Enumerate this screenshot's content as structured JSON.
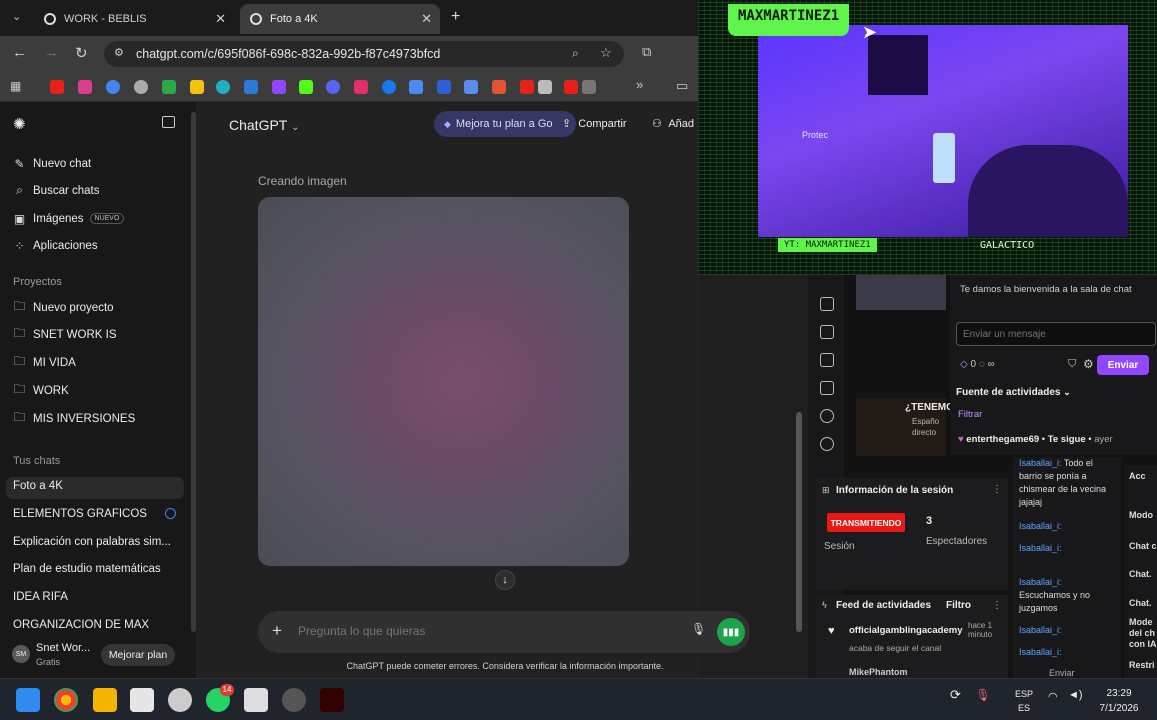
{
  "browser": {
    "tabs": [
      {
        "label": "WORK - BEBLIS"
      },
      {
        "label": "Foto a 4K"
      }
    ],
    "url": "chatgpt.com/c/695f086f-698c-832a-992b-f87c4973bfcd"
  },
  "sidebar": {
    "top_items": [
      {
        "label": "Nuevo chat",
        "icon": "edit-icon"
      },
      {
        "label": "Buscar chats",
        "icon": "search-icon"
      },
      {
        "label": "Imágenes",
        "icon": "image-icon",
        "badge": "NUEVO"
      },
      {
        "label": "Aplicaciones",
        "icon": "apps-icon"
      }
    ],
    "projects_heading": "Proyectos",
    "projects": [
      {
        "label": "Nuevo proyecto",
        "icon": "folder-plus-icon"
      },
      {
        "label": "SNET WORK IS",
        "icon": "folder-icon"
      },
      {
        "label": "MI VIDA",
        "icon": "folder-icon"
      },
      {
        "label": "WORK",
        "icon": "folder-icon"
      },
      {
        "label": "MIS INVERSIONES",
        "icon": "folder-icon"
      }
    ],
    "chats_heading": "Tus chats",
    "chats": [
      {
        "label": "Foto a 4K"
      },
      {
        "label": "ELEMENTOS GRAFICOS"
      },
      {
        "label": "Explicación con palabras sim..."
      },
      {
        "label": "Plan de estudio matemáticas"
      },
      {
        "label": "IDEA RIFA"
      },
      {
        "label": "ORGANIZACION DE MAX"
      }
    ],
    "user": {
      "initials": "SM",
      "name": "Snet Wor...",
      "plan": "Gratis",
      "upgrade_label": "Mejorar plan"
    }
  },
  "main": {
    "model_title": "ChatGPT",
    "go_label": "Mejora tu plan a Go",
    "share_label": "Compartir",
    "add_label": "Añad",
    "status": "Creando imagen",
    "composer_placeholder": "Pregunta lo que quieras",
    "disclaimer": "ChatGPT puede cometer errores. Considera verificar la información importante."
  },
  "stream": {
    "streamer": "MAXMARTINEZ1",
    "yt_tag": "YT: MAXMARTINEZ1",
    "tag2": "GALACTICO",
    "cam_label": "Protec"
  },
  "twitch": {
    "preview_title": "¿TENEMO",
    "preview_lines": [
      "Españo",
      "directo"
    ],
    "welcome": "Te damos la bienvenida a la sala de chat",
    "input_placeholder": "Enviar un mensaje",
    "points": "0",
    "send_label": "Enviar",
    "activity_heading": "Fuente de actividades",
    "filter_label": "Filtrar",
    "follower_name": "enterthegame69",
    "follower_action": "Te sigue",
    "follower_time": "ayer",
    "session_title": "Información de la sesión",
    "live_badge": "TRANSMITIENDO",
    "viewers": "3",
    "session_label": "Sesión",
    "viewers_label": "Espectadores",
    "feed_title": "Feed de actividades",
    "feed_filter": "Filtro",
    "feed_user": "officialgamblingacademy",
    "feed_sub": "acaba de seguir el canal",
    "feed_time": "hace 1 minuto",
    "feed_next": "MikePhantom",
    "chat_messages": [
      {
        "name": "Isaballai_i:",
        "text": "Todo el barrio se ponía a chismear de la vecina jajajaj"
      },
      {
        "name": "Isaballai_i:",
        "text": ""
      },
      {
        "name": "Isaballai_i:",
        "text": ""
      },
      {
        "name": "Isaballai_i:",
        "text": "Escuchamos y no juzgamos"
      },
      {
        "name": "Isaballai_i:",
        "text": ""
      },
      {
        "name": "Isaballai_i:",
        "text": ""
      }
    ],
    "chat_send": "Enviar",
    "settings_items": [
      "Acc",
      "Modo",
      "Chat c",
      "Chat.",
      "Chat.",
      "Mode del ch con IA",
      "Restri"
    ]
  },
  "taskbar": {
    "lang_top": "ESP",
    "lang_bottom": "ES",
    "time": "23:29",
    "date": "7/1/2026",
    "whatsapp_badge": "14"
  }
}
